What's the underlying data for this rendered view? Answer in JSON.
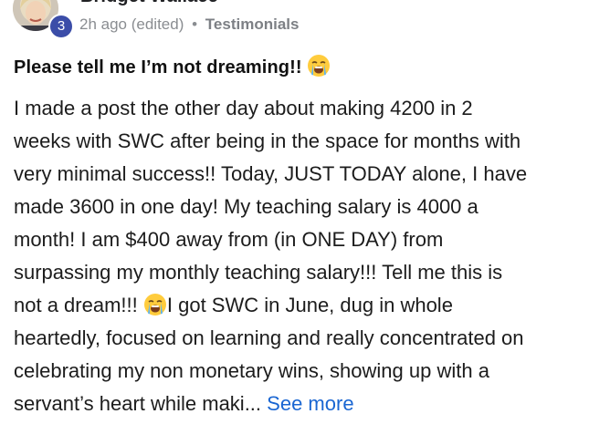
{
  "post": {
    "author": {
      "name": "Bridget Wallace",
      "level": "3"
    },
    "meta": {
      "time": "2h ago (edited)",
      "separator": "•",
      "category": "Testimonials"
    },
    "title": "Please tell me I’m not dreaming!!",
    "title_emoji": "loudly-crying-face-emoji",
    "body_lines": [
      "I made a post the other day about making 4200 in 2",
      "weeks with SWC after being in the space for months with",
      "very minimal success!! Today, JUST TODAY alone, I have",
      "made 3600 in one day! My teaching salary is 4000 a",
      "month! I am $400 away from (in ONE DAY) from",
      "surpassing my monthly teaching salary!!! Tell me this is",
      "not a dream!!!",
      "I got SWC in June, dug in whole",
      "heartedly, focused on learning and really concentrated on",
      "celebrating my non monetary wins, showing up with a",
      "servant’s heart while maki..."
    ],
    "see_more": "See more",
    "colors": {
      "link": "#1a66d2",
      "badge": "#3b4da8",
      "meta": "#8a8d91"
    }
  }
}
